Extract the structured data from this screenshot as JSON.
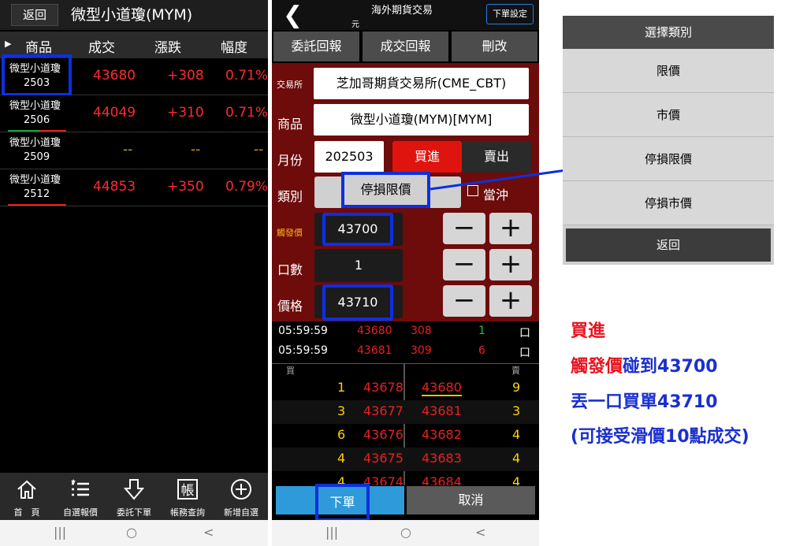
{
  "colors": {
    "accent_highlight": "#0d2fe0",
    "up": "#ff2a2a",
    "form_bg": "#6e0b0b",
    "buy_btn": "#e0140e",
    "submit_btn": "#2e9ad9"
  },
  "watchlist": {
    "back_label": "返回",
    "title": "微型小道瓊(MYM)",
    "columns": [
      "商品",
      "成交",
      "漲跌",
      "幅度"
    ],
    "rows": [
      {
        "name": "微型小道瓊",
        "code": "2503",
        "price": "43680",
        "change": "+308",
        "pct": "0.71%"
      },
      {
        "name": "微型小道瓊",
        "code": "2506",
        "price": "44049",
        "change": "+310",
        "pct": "0.71%"
      },
      {
        "name": "微型小道瓊",
        "code": "2509",
        "price": "--",
        "change": "--",
        "pct": "--"
      },
      {
        "name": "微型小道瓊",
        "code": "2512",
        "price": "44853",
        "change": "+350",
        "pct": "0.79%"
      }
    ],
    "nav": [
      {
        "icon": "home-icon",
        "label": "首　頁"
      },
      {
        "icon": "list-star-icon",
        "label": "自選報價"
      },
      {
        "icon": "download-arrow-icon",
        "label": "委託下單"
      },
      {
        "icon": "ledger-icon",
        "label": "帳務查詢",
        "glyph": "帳"
      },
      {
        "icon": "add-circle-icon",
        "label": "新增自選"
      }
    ]
  },
  "order": {
    "title": "海外期貨交易",
    "unit": "元",
    "settings_label": "下單設定",
    "tabs": [
      "委託回報",
      "成交回報",
      "刪改"
    ],
    "exchange_label": "交易所",
    "exchange_value": "芝加哥期貨交易所(CME_CBT)",
    "product_label": "商品",
    "product_value": "微型小道瓊(MYM)[MYM]",
    "month_label": "月份",
    "month_value": "202503",
    "buy_label": "買進",
    "sell_label": "賣出",
    "type_label": "類別",
    "type_value": "停損限價",
    "daytrade_label": "當沖",
    "trigger_label": "觸發價",
    "trigger_value": "43700",
    "qty_label": "口數",
    "qty_value": "1",
    "price_label": "價格",
    "price_value": "43710",
    "minus": "−",
    "plus": "+",
    "ticks": [
      {
        "time": "05:59:59",
        "price": "43680",
        "change": "308",
        "vol": "1",
        "flag": "口"
      },
      {
        "time": "05:59:59",
        "price": "43681",
        "change": "309",
        "vol": "6",
        "flag": "口"
      }
    ],
    "book_bid_header": "買",
    "book_ask_header": "賣",
    "book": [
      {
        "bid_qty": "1",
        "bid": "43678",
        "ask": "43680",
        "ask_qty": "9"
      },
      {
        "bid_qty": "3",
        "bid": "43677",
        "ask": "43681",
        "ask_qty": "3"
      },
      {
        "bid_qty": "6",
        "bid": "43676",
        "ask": "43682",
        "ask_qty": "4"
      },
      {
        "bid_qty": "4",
        "bid": "43675",
        "ask": "43683",
        "ask_qty": "4"
      },
      {
        "bid_qty": "4",
        "bid": "43674",
        "ask": "43684",
        "ask_qty": "4"
      }
    ],
    "submit_label": "下單",
    "cancel_label": "取消"
  },
  "picker": {
    "title": "選擇類別",
    "options": [
      "限價",
      "市價",
      "停損限價",
      "停損市價"
    ],
    "back_label": "返回"
  },
  "annotation": {
    "line1": "買進",
    "line2_a": "觸發價",
    "line2_b": "碰到43700",
    "line3": "丟一口買單43710",
    "line4": "(可接受滑價10點成交)"
  },
  "system_nav": [
    "|||",
    "○",
    "<"
  ]
}
